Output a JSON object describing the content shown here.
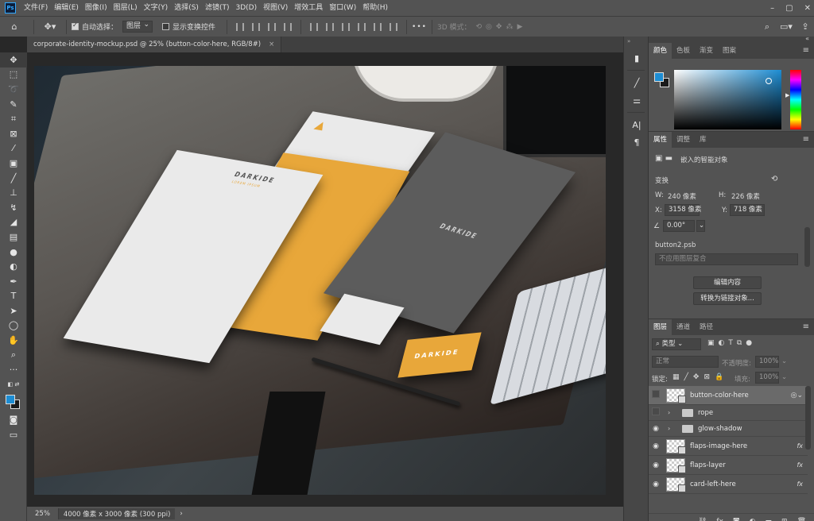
{
  "app": {
    "logo": "Ps",
    "menu": [
      "文件(F)",
      "编辑(E)",
      "图像(I)",
      "图层(L)",
      "文字(Y)",
      "选择(S)",
      "滤镜(T)",
      "3D(D)",
      "视图(V)",
      "增效工具",
      "窗口(W)",
      "帮助(H)"
    ],
    "window_controls": [
      "–",
      "▢",
      "✕"
    ]
  },
  "options": {
    "auto_select_label": "自动选择：",
    "auto_select_checked": true,
    "auto_select_target": "图层",
    "show_transform_label": "显示变换控件",
    "show_transform_checked": false,
    "more": "•••",
    "mode_3d": "3D 模式："
  },
  "document": {
    "tab_title": "corporate-identity-mockup.psd @ 25% (button-color-here, RGB/8#)",
    "tab_close": "×",
    "zoom": "25%",
    "doc_info": "4000 像素 x 3000 像素 (300 ppi)",
    "status_arrow": "›"
  },
  "mockup": {
    "brand": "DARKIDE",
    "brand_sub": "LOREM IPSUM"
  },
  "color_panel": {
    "tabs": [
      "颜色",
      "色板",
      "渐变",
      "图案"
    ],
    "foreground": "#1d8dd3",
    "background": "#1a1a1a"
  },
  "properties_panel": {
    "tabs": [
      "属性",
      "调整",
      "库"
    ],
    "type_label": "嵌入的智能对象",
    "transform_label": "变换",
    "w_label": "W:",
    "w_value": "240 像素",
    "h_label": "H:",
    "h_value": "226 像素",
    "x_label": "X:",
    "x_value": "3158 像素",
    "y_label": "Y:",
    "y_value": "718 像素",
    "angle_value": "0.00°",
    "linked_file": "button2.psb",
    "layer_comp": "不应用图层复合",
    "edit_contents": "编辑内容",
    "convert_linked": "转换为链接对象..."
  },
  "layers_panel": {
    "tabs": [
      "图层",
      "通道",
      "路径"
    ],
    "filter_kind": "类型",
    "blend_mode": "正常",
    "opacity_label": "不透明度:",
    "opacity_value": "100%",
    "lock_label": "锁定:",
    "fill_label": "填充:",
    "fill_value": "100%",
    "layers": [
      {
        "name": "button-color-here",
        "type": "smart",
        "visible": false,
        "selected": true,
        "fx": false
      },
      {
        "name": "rope",
        "type": "group",
        "visible": false,
        "selected": false,
        "fx": false
      },
      {
        "name": "glow-shadow",
        "type": "group",
        "visible": true,
        "selected": false,
        "fx": false
      },
      {
        "name": "flaps-image-here",
        "type": "smart",
        "visible": true,
        "selected": false,
        "fx": true
      },
      {
        "name": "flaps-layer",
        "type": "smart",
        "visible": true,
        "selected": false,
        "fx": true
      },
      {
        "name": "card-left-here",
        "type": "smart",
        "visible": true,
        "selected": false,
        "fx": true
      }
    ],
    "fx_label": "fx"
  }
}
